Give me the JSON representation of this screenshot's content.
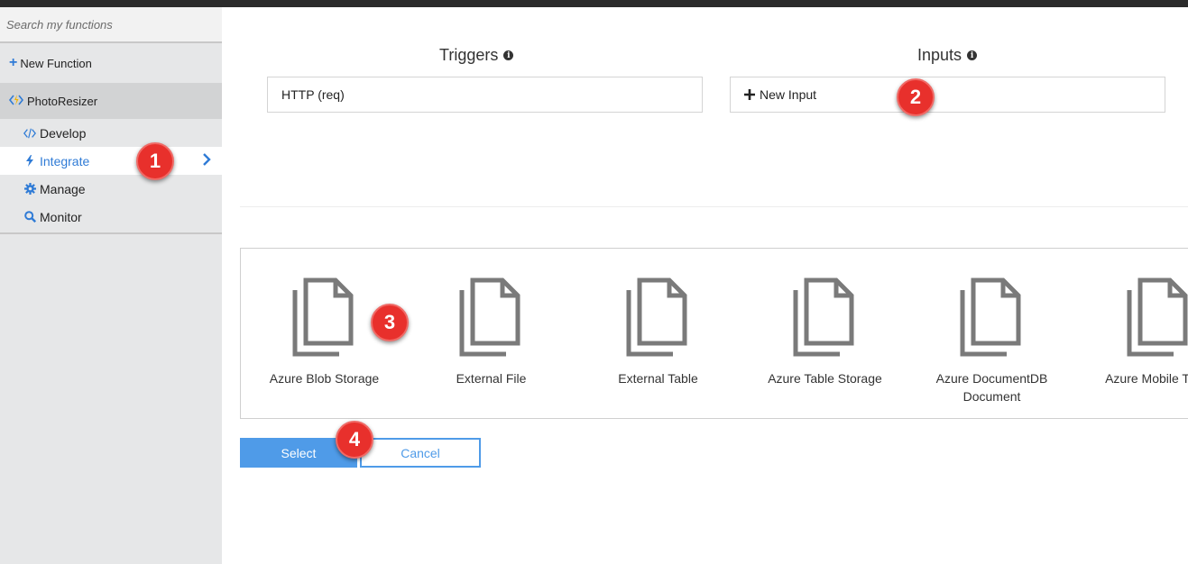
{
  "sidebar": {
    "search_placeholder": "Search my functions",
    "new_function_label": "New Function",
    "function_name": "PhotoResizer",
    "nav": [
      {
        "label": "Develop",
        "icon": "code-icon"
      },
      {
        "label": "Integrate",
        "icon": "lightning-icon"
      },
      {
        "label": "Manage",
        "icon": "gear-icon"
      },
      {
        "label": "Monitor",
        "icon": "search-icon"
      }
    ]
  },
  "main": {
    "triggers_title": "Triggers",
    "trigger_value": "HTTP (req)",
    "inputs_title": "Inputs",
    "new_input_label": "New Input",
    "templates": [
      {
        "label": "Azure Blob Storage"
      },
      {
        "label": "External File"
      },
      {
        "label": "External Table"
      },
      {
        "label": "Azure Table Storage"
      },
      {
        "label": "Azure DocumentDB Document"
      },
      {
        "label": "Azure Mobile Table"
      }
    ],
    "select_label": "Select",
    "cancel_label": "Cancel"
  },
  "badges": [
    "1",
    "2",
    "3",
    "4"
  ],
  "colors": {
    "accent": "#2f7bd6",
    "button": "#4f9be8",
    "badge": "#e8302c",
    "sidebar_bg": "#e6e7e8"
  }
}
